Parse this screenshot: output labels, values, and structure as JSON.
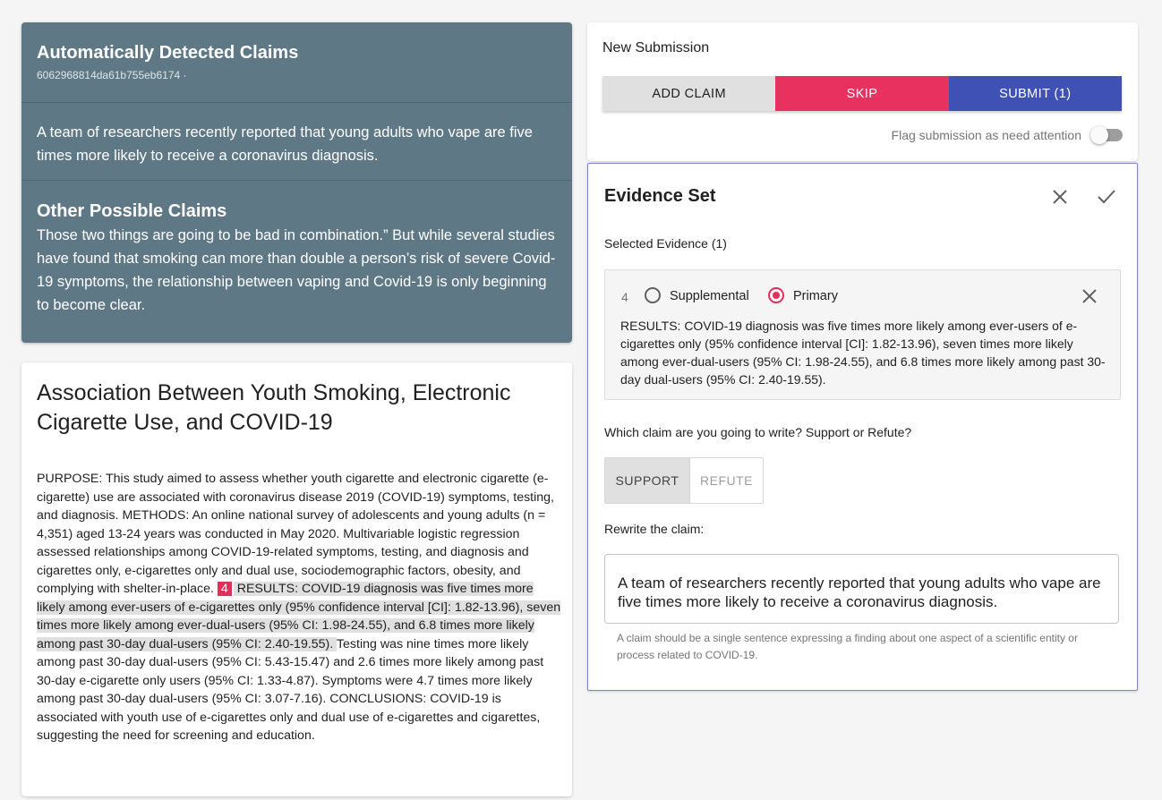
{
  "claims_panel": {
    "title": "Automatically Detected Claims",
    "id_text": "6062968814da61b755eb6174 ·",
    "main_claim": "A team of researchers recently reported that young adults who vape are five times more likely to receive a coronavirus diagnosis.",
    "other_title": "Other Possible Claims",
    "other_text": "Those two things are going to be bad in combination.” But while several studies have found that smoking can more than double a person’s risk of severe Covid-19 symptoms, the relationship between vaping and Covid-19 is only beginning to become clear."
  },
  "paper": {
    "title": "Association Between Youth Smoking, Electronic Cigarette Use, and COVID-19",
    "abstract_before": " PURPOSE: This study aimed to assess whether youth cigarette and electronic cigarette (e-cigarette) use are associated with coronavirus disease 2019 (COVID-19) symptoms, testing, and diagnosis.  METHODS: An online national survey of adolescents and young adults (n = 4,351) aged 13-24 years was conducted in May 2020.  Multivariable logistic regression assessed relationships among COVID-19-related symptoms, testing, and diagnosis and cigarettes only, e-cigarettes only and dual use, sociodemographic factors, obesity, and complying with shelter-in-place. ",
    "marker": "4",
    "abstract_highlight": " RESULTS: COVID-19 diagnosis was five times more likely among ever-users of e-cigarettes only (95% confidence interval [CI]: 1.82-13.96), seven times more likely among ever-dual-users (95% CI: 1.98-24.55), and 6.8 times more likely among past 30-day dual-users (95% CI: 2.40-19.55). ",
    "abstract_after": " Testing was nine times more likely among past 30-day dual-users (95% CI: 5.43-15.47) and 2.6 times more likely among past 30-day e-cigarette only users (95% CI: 1.33-4.87).  Symptoms were 4.7 times more likely among past 30-day dual-users (95% CI: 3.07-7.16).  CONCLUSIONS: COVID-19 is associated with youth use of e-cigarettes only and dual use of e-cigarettes and cigarettes, suggesting the need for screening and education."
  },
  "submission": {
    "title": "New Submission",
    "add_claim": "ADD CLAIM",
    "skip": "SKIP",
    "submit": "SUBMIT (1)",
    "flag_label": "Flag submission as need attention"
  },
  "evidence": {
    "title": "Evidence Set",
    "selected_label": "Selected Evidence (1)",
    "item_number": "4",
    "option_supplemental": "Supplemental",
    "option_primary": "Primary",
    "selected_option": "Primary",
    "item_text": "RESULTS: COVID-19 diagnosis was five times more likely among ever-users of e-cigarettes only (95% confidence interval [CI]: 1.82-13.96), seven times more likely among ever-dual-users (95% CI: 1.98-24.55), and 6.8 times more likely among past 30-day dual-users (95% CI: 2.40-19.55).",
    "which_label": "Which claim are you going to write? Support or Refute?",
    "support": "SUPPORT",
    "refute": "REFUTE",
    "selected_stance": "SUPPORT",
    "rewrite_label": "Rewrite the claim:",
    "rewrite_value": "A team of researchers recently reported that young adults who vape are five times more likely to receive a coronavirus diagnosis.",
    "helper": "A claim should be a single sentence expressing a finding about one aspect of a scientific entity or process related to COVID-19."
  },
  "colors": {
    "claims_bg": "#5f7886",
    "skip": "#e8315e",
    "submit": "#3f51b5",
    "accent": "#e0305a",
    "evidence_border": "#7986cb"
  },
  "icons": [
    "close-icon",
    "check-icon",
    "remove-evidence-icon"
  ]
}
